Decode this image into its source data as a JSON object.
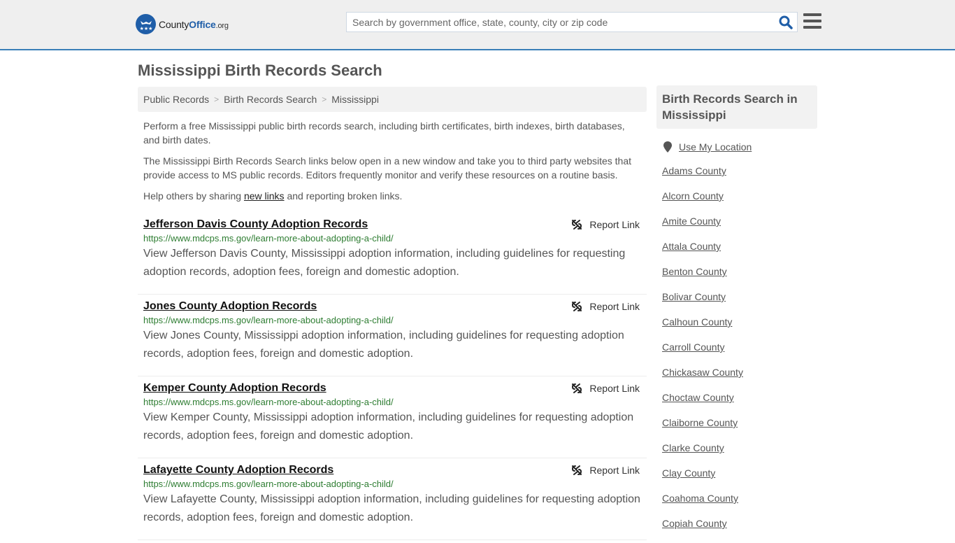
{
  "header": {
    "logo": {
      "brand_part1": "County",
      "brand_part2": "Office",
      "brand_tld": ".org"
    },
    "search": {
      "placeholder": "Search by government office, state, county, city or zip code",
      "value": ""
    },
    "accent_color": "#3a7fb8"
  },
  "page": {
    "title": "Mississippi Birth Records Search"
  },
  "breadcrumb": [
    {
      "label": "Public Records"
    },
    {
      "label": "Birth Records Search"
    },
    {
      "label": "Mississippi"
    }
  ],
  "intro": {
    "p1": "Perform a free Mississippi public birth records search, including birth certificates, birth indexes, birth databases, and birth dates.",
    "p2": "The Mississippi Birth Records Search links below open in a new window and take you to third party websites that provide access to MS public records. Editors frequently monitor and verify these resources on a routine basis.",
    "p3_before": "Help others by sharing ",
    "p3_link": "new links",
    "p3_after": " and reporting broken links."
  },
  "results": [
    {
      "title": "Jefferson Davis County Adoption Records",
      "url": "https://www.mdcps.ms.gov/learn-more-about-adopting-a-child/",
      "description": "View Jefferson Davis County, Mississippi adoption information, including guidelines for requesting adoption records, adoption fees, foreign and domestic adoption.",
      "report_label": "Report Link"
    },
    {
      "title": "Jones County Adoption Records",
      "url": "https://www.mdcps.ms.gov/learn-more-about-adopting-a-child/",
      "description": "View Jones County, Mississippi adoption information, including guidelines for requesting adoption records, adoption fees, foreign and domestic adoption.",
      "report_label": "Report Link"
    },
    {
      "title": "Kemper County Adoption Records",
      "url": "https://www.mdcps.ms.gov/learn-more-about-adopting-a-child/",
      "description": "View Kemper County, Mississippi adoption information, including guidelines for requesting adoption records, adoption fees, foreign and domestic adoption.",
      "report_label": "Report Link"
    },
    {
      "title": "Lafayette County Adoption Records",
      "url": "https://www.mdcps.ms.gov/learn-more-about-adopting-a-child/",
      "description": "View Lafayette County, Mississippi adoption information, including guidelines for requesting adoption records, adoption fees, foreign and domestic adoption.",
      "report_label": "Report Link"
    }
  ],
  "sidebar": {
    "heading": "Birth Records Search in Mississippi",
    "use_location": "Use My Location",
    "counties": [
      "Adams County",
      "Alcorn County",
      "Amite County",
      "Attala County",
      "Benton County",
      "Bolivar County",
      "Calhoun County",
      "Carroll County",
      "Chickasaw County",
      "Choctaw County",
      "Claiborne County",
      "Clarke County",
      "Clay County",
      "Coahoma County",
      "Copiah County"
    ]
  }
}
